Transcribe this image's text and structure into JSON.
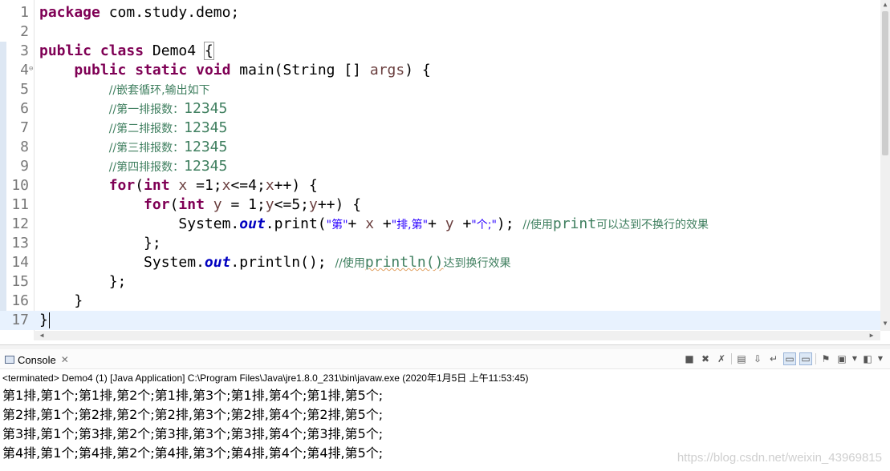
{
  "editor": {
    "line_numbers": [
      "1",
      "2",
      "3",
      "4",
      "5",
      "6",
      "7",
      "8",
      "9",
      "10",
      "11",
      "12",
      "13",
      "14",
      "15",
      "16",
      "17"
    ],
    "code": {
      "l1": {
        "kw_package": "package",
        "rest": " com.study.demo;"
      },
      "l3": {
        "kw_public": "public",
        "kw_class": "class",
        "class_name": " Demo4 ",
        "open_brace": "{"
      },
      "l4": {
        "indent": "    ",
        "kw_public": "public",
        "kw_static": "static",
        "kw_void": "void",
        "sig": " main(String [] ",
        "param": "args",
        "tail": ") {"
      },
      "l5": {
        "indent": "        ",
        "comment": "//嵌套循环,输出如下"
      },
      "l6": {
        "indent": "        ",
        "comment_prefix": "//第一排报数：",
        "comment_num": "12345"
      },
      "l7": {
        "indent": "        ",
        "comment_prefix": "//第二排报数：",
        "comment_num": "12345"
      },
      "l8": {
        "indent": "        ",
        "comment_prefix": "//第三排报数：",
        "comment_num": "12345"
      },
      "l9": {
        "indent": "        ",
        "comment_prefix": "//第四排报数：",
        "comment_num": "12345"
      },
      "l10": {
        "indent": "        ",
        "kw_for": "for",
        "p1": "(",
        "kw_int": "int",
        "v1": " x",
        "p2": " =1;",
        "v2": "x",
        "p3": "<=4;",
        "v3": "x",
        "p4": "++) {"
      },
      "l11": {
        "indent": "            ",
        "kw_for": "for",
        "p1": "(",
        "kw_int": "int",
        "v1": " y",
        "p2": " = 1;",
        "v2": "y",
        "p3": "<=5;",
        "v3": "y",
        "p4": "++) {"
      },
      "l12": {
        "indent": "                ",
        "sys": "System.",
        "out": "out",
        "call": ".print(",
        "s1": "\"第\"",
        "plus1": "+ ",
        "vx": "x",
        "plus2": " +",
        "s2": "\"排,第\"",
        "plus3": "+ ",
        "vy": "y",
        "plus4": " +",
        "s3": "\"个;\"",
        "end": "); ",
        "comment_a": "//使用",
        "comment_b": "print",
        "comment_c": "可以达到不换行的效果"
      },
      "l13": {
        "indent": "            ",
        "text": "};"
      },
      "l14": {
        "indent": "            ",
        "sys": "System.",
        "out": "out",
        "call": ".println(); ",
        "comment_a": "//使用",
        "comment_b": "println()",
        "comment_c": "达到换行效果"
      },
      "l15": {
        "indent": "        ",
        "text": "};"
      },
      "l16": {
        "indent": "    ",
        "text": "}"
      },
      "l17": {
        "text": "}"
      }
    }
  },
  "console": {
    "tab_label": "Console",
    "tab_close": "✕",
    "status_line": "<terminated> Demo4 (1) [Java Application] C:\\Program Files\\Java\\jre1.8.0_231\\bin\\javaw.exe (2020年1月5日 上午11:53:45)",
    "output": [
      "第1排,第1个;第1排,第2个;第1排,第3个;第1排,第4个;第1排,第5个;",
      "第2排,第1个;第2排,第2个;第2排,第3个;第2排,第4个;第2排,第5个;",
      "第3排,第1个;第3排,第2个;第3排,第3个;第3排,第4个;第3排,第5个;",
      "第4排,第1个;第4排,第2个;第4排,第3个;第4排,第4个;第4排,第5个;"
    ],
    "watermark": "https://blog.csdn.net/weixin_43969815"
  },
  "toolbar_icons": [
    "terminate-icon",
    "remove-launch-icon",
    "remove-all-terminated-icon",
    "clear-console-icon",
    "scroll-lock-icon",
    "word-wrap-icon",
    "show-on-stdout-icon",
    "show-on-stderr-icon",
    "pin-console-icon",
    "display-selected-console-icon",
    "open-console-icon"
  ],
  "colors": {
    "keyword": "#7f0055",
    "comment": "#3f7f5f",
    "string": "#2a00ff",
    "field": "#0000c0",
    "current_line": "#e8f2fe"
  }
}
